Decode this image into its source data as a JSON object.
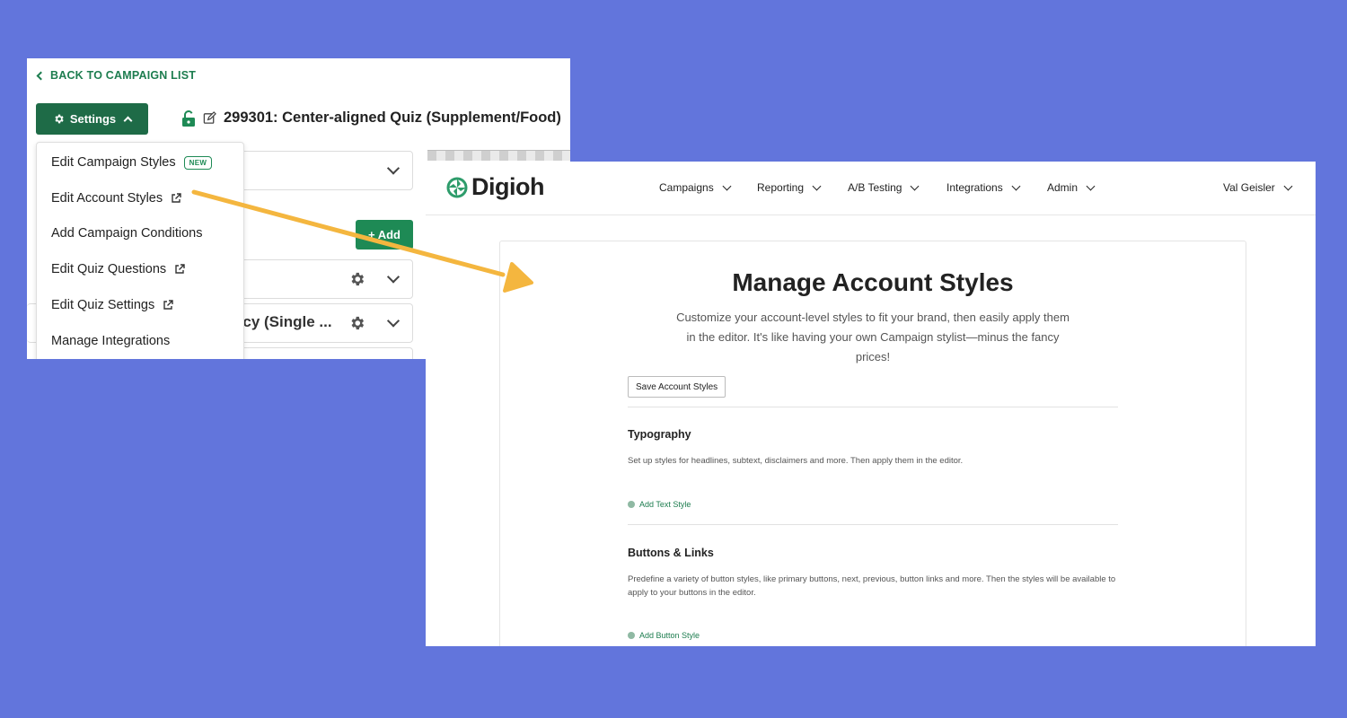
{
  "editor": {
    "back_link": "BACK TO CAMPAIGN LIST",
    "settings_button": "Settings",
    "campaign_title": "299301: Center-aligned Quiz (Supplement/Food)",
    "add_button": "+ Add",
    "partial_card_text": "ncy (Single ...",
    "dropdown": {
      "items": [
        {
          "label": "Edit Campaign Styles",
          "badge": "NEW"
        },
        {
          "label": "Edit Account Styles"
        },
        {
          "label": "Add Campaign Conditions"
        },
        {
          "label": "Edit Quiz Questions"
        },
        {
          "label": "Edit Quiz Settings"
        },
        {
          "label": "Manage Integrations"
        }
      ]
    }
  },
  "account_styles": {
    "logo": "Digioh",
    "nav": {
      "campaigns": "Campaigns",
      "reporting": "Reporting",
      "ab_testing": "A/B Testing",
      "integrations": "Integrations",
      "admin": "Admin",
      "user": "Val Geisler"
    },
    "title": "Manage Account Styles",
    "description": "Customize your account-level styles to fit your brand, then easily apply them in the editor. It's like having your own Campaign stylist—minus the fancy prices!",
    "save_button": "Save Account Styles",
    "sections": [
      {
        "title": "Typography",
        "description": "Set up styles for headlines, subtext, disclaimers and more. Then apply them in the editor.",
        "add_label": "Add Text Style"
      },
      {
        "title": "Buttons & Links",
        "description": "Predefine a variety of button styles, like primary buttons, next, previous, button links and more. Then the styles will be available to apply to your buttons in the editor.",
        "add_label": "Add Button Style"
      }
    ]
  },
  "colors": {
    "background": "#6275dc",
    "brand_green": "#1e6b47",
    "arrow": "#f4b63f"
  }
}
